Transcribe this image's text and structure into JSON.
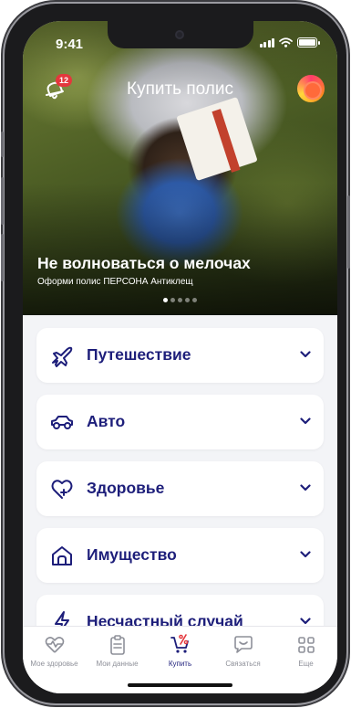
{
  "status_bar": {
    "time": "9:41"
  },
  "header": {
    "title": "Купить полис",
    "notifications_count": "12",
    "bell_icon": "bell-icon",
    "avatar_icon": "avatar"
  },
  "promo": {
    "title": "Не волноваться о мелочах",
    "subtitle": "Оформи полис ПЕРСОНА Антиклещ",
    "slides_total": 5,
    "active_slide": 1
  },
  "categories": [
    {
      "label": "Путешествие",
      "icon": "airplane-icon"
    },
    {
      "label": "Авто",
      "icon": "car-icon"
    },
    {
      "label": "Здоровье",
      "icon": "heart-plus-icon"
    },
    {
      "label": "Имущество",
      "icon": "house-icon"
    },
    {
      "label": "Несчастный случай",
      "icon": "lightning-icon"
    }
  ],
  "tabbar": {
    "items": [
      {
        "label": "Мое здоровье",
        "icon": "heart-pulse-icon"
      },
      {
        "label": "Мои данные",
        "icon": "clipboard-icon"
      },
      {
        "label": "Купить",
        "icon": "cart-percent-icon"
      },
      {
        "label": "Связаться",
        "icon": "chat-icon"
      },
      {
        "label": "Еще",
        "icon": "grid-icon"
      }
    ],
    "active": "Купить"
  },
  "colors": {
    "brand_navy": "#1d1e7a",
    "accent_red": "#e4373c",
    "inactive_gray": "#8e9099"
  }
}
